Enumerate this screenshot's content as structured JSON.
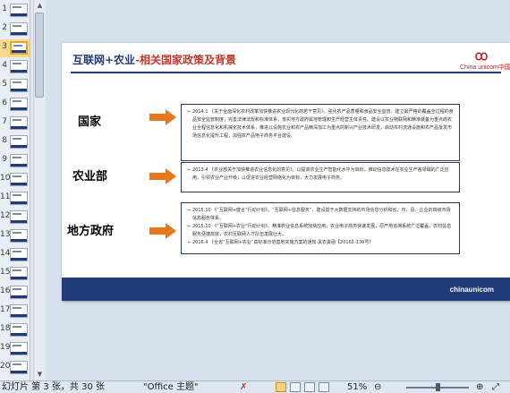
{
  "thumbnails": [
    {
      "num": "1"
    },
    {
      "num": "2"
    },
    {
      "num": "3",
      "selected": true
    },
    {
      "num": "4"
    },
    {
      "num": "5"
    },
    {
      "num": "6"
    },
    {
      "num": "7"
    },
    {
      "num": "8"
    },
    {
      "num": "9"
    },
    {
      "num": "10"
    },
    {
      "num": "11"
    },
    {
      "num": "12"
    },
    {
      "num": "13"
    },
    {
      "num": "14"
    },
    {
      "num": "15"
    },
    {
      "num": "16"
    },
    {
      "num": "17"
    },
    {
      "num": "18"
    },
    {
      "num": "19"
    },
    {
      "num": "20"
    }
  ],
  "slide": {
    "title_part1": "互联网+农业",
    "title_part2": "-相关国家政策及背景",
    "logo_text": "China unicom中国联通",
    "footer_logo": "chinaunicom",
    "categories": [
      {
        "label": "国家",
        "items": [
          "2014.1 《关于全面深化农村改革加快推进农业现代化的若干意见》。强化农产品质量和食品安全监管。建立最严格的覆盖全过程的食品安全监管制度，完善法律法规和标准体系，落实地方政府属地管理和生产经营主体责任。建设以农业物联网和精准装备为重点的农业全程信息化和机械化技术体系，推进以设施农业和农产品精深加工为重点的新兴产业技术研发，启动农村流通设施和农产品批发市场信息化提升工程，加强农产品电子商务平台建设。"
        ]
      },
      {
        "label": "农业部",
        "items": [
          "2013.4 《农业部关于加快推进农业信息化的意见》。以提高农业生产智能化水平为目标，推动信息技术在农业生产各领域的广泛应用，引领农业产业升级；以促进农业经营网络化为目标，大力发展电子商务。"
        ]
      },
      {
        "label": "地方政府",
        "items": [
          "2015.10 《“互联网+健合”行动计划》。“互联网+信息服务”，建设基于大数据支持的市场信息分析和省、市、县、企业的四级市场信息服务体系。",
          "2015.10 《“互联网+农业”行动计划》。精准农业信息系统加快应用；农业电子商务快速发展，原产地追溯系统广泛覆盖，农村信息服务便捷高效，农村互联网人才队伍发展壮大。",
          "2016.4 《全省“互联网+农业”高标准示范基地实施方案的通知·黑农委函【2016】130号》"
        ]
      }
    ]
  },
  "status_bar": {
    "slide_info": "幻灯片 第 3 张，共 30 张",
    "theme": "\"Office 主题\"",
    "zoom": "51%",
    "zoom_out": "⊖",
    "zoom_in": "⊕"
  }
}
